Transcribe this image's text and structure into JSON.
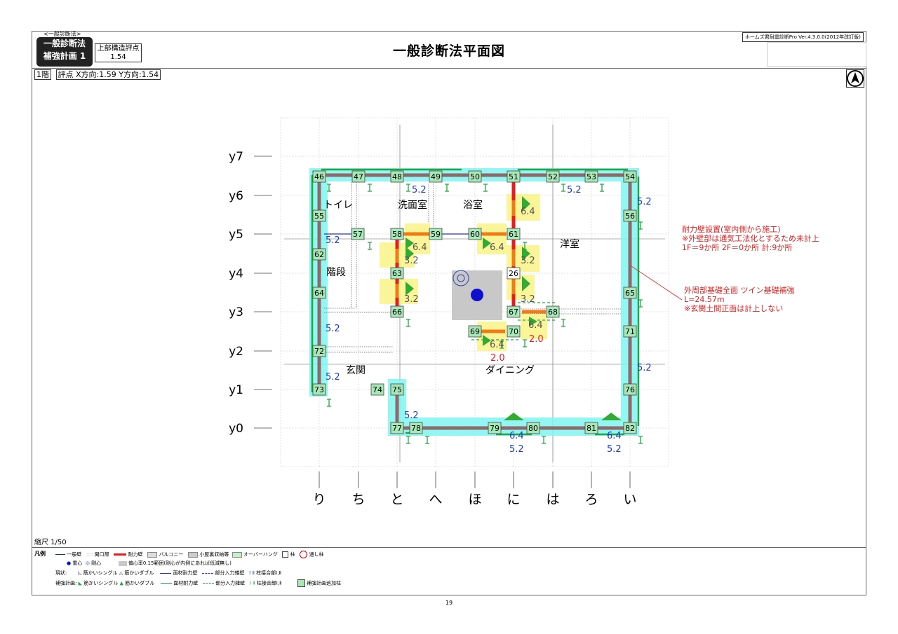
{
  "header": {
    "small_tag": "<一般診断法>",
    "method_label": "一般診断法",
    "plan_label": "補強計画 1",
    "eval_label": "上部構造評点",
    "eval_value": "1.54",
    "title": "一般診断法平面図",
    "version": "ホームズ君耐震診断Pro Ver.4.3.0.0(2012年改訂版)"
  },
  "floor": {
    "floor_label": "1階",
    "score_label": "評点 X方向:1.59  Y方向:1.54"
  },
  "grid": {
    "y_labels": [
      "y7",
      "y6",
      "y5",
      "y4",
      "y3",
      "y2",
      "y1",
      "y0"
    ],
    "x_labels": [
      "り",
      "ち",
      "と",
      "へ",
      "ほ",
      "に",
      "は",
      "ろ",
      "い"
    ]
  },
  "rooms": [
    "トイレ",
    "洗面室",
    "浴室",
    "洋室",
    "階段",
    "玄関",
    "ダイニング"
  ],
  "columns": [
    "46",
    "47",
    "48",
    "49",
    "50",
    "51",
    "52",
    "53",
    "54",
    "55",
    "56",
    "57",
    "58",
    "59",
    "60",
    "61",
    "62",
    "63",
    "26",
    "64",
    "65",
    "66",
    "67",
    "68",
    "69",
    "70",
    "71",
    "72",
    "73",
    "74",
    "75",
    "76",
    "77",
    "78",
    "79",
    "80",
    "81",
    "82"
  ],
  "values": [
    "5.2",
    "6.4",
    "3.2",
    "2.0"
  ],
  "notes": {
    "note1": [
      "耐力壁設置(室内側から施工)",
      "※外壁部は通気工法化とするため未計上",
      "1F＝9か所  2F＝0か所  計:9か所"
    ],
    "note2": [
      "外周部基礎全面  ツイン基礎補強",
      "L=24.57m",
      "※玄関土間正面は計上しない"
    ]
  },
  "scale": "縮尺 1/50",
  "legend": {
    "title": "凡例",
    "row1": [
      "一般壁",
      "開口部",
      "耐力壁",
      "バルコニー",
      "小屋裏収納等",
      "オーバーハング",
      "柱",
      "通し柱"
    ],
    "row2": [
      "重心",
      "剛心",
      "偏心率0.15範囲(剛心が内側にあれば低減無し)"
    ],
    "row3_label": "現状:",
    "row3": [
      "筋かいシングル",
      "筋かいダブル",
      "面材耐力壁",
      "部分入力雑壁",
      "柱接合部Ⅰ,Ⅱ"
    ],
    "row4_label": "補強計画:",
    "row4": [
      "筋かいシングル",
      "筋かいダブル",
      "面材耐力壁",
      "部分入力雑壁",
      "柱接合部Ⅰ,Ⅱ",
      "補強計画追加柱"
    ]
  },
  "page_number": "19",
  "colors": {
    "cyan": "#7ff5f2",
    "wall": "#8c6a6a",
    "red": "#e81c1c",
    "green": "#22a544",
    "column": "#a8e8b8",
    "blue_text": "#1a3ccc",
    "orange": "#f07a14",
    "yellow": "#fbf59a"
  }
}
